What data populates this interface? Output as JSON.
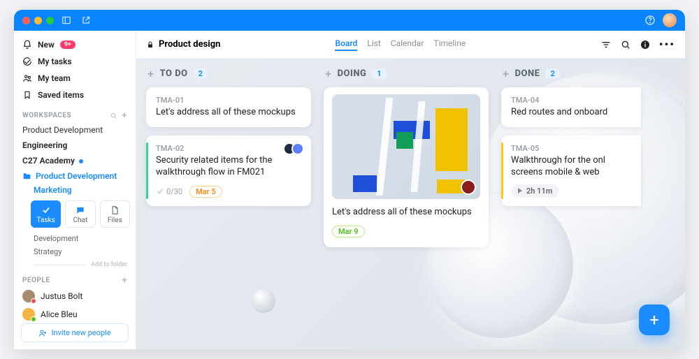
{
  "titlebar": {},
  "sidebar": {
    "new_label": "New",
    "new_count": "9+",
    "my_tasks": "My tasks",
    "my_team": "My team",
    "saved": "Saved items",
    "workspaces_title": "WORKSPACES",
    "workspaces": [
      "Product Development",
      "Engineering",
      "C27 Academy"
    ],
    "folder": "Product Development",
    "subfolder": "Marketing",
    "tabs": {
      "tasks": "Tasks",
      "chat": "Chat",
      "files": "Files"
    },
    "sub1": "Development",
    "sub2": "Strategy",
    "add_folder": "Add to folder",
    "people_title": "PEOPLE",
    "people": [
      {
        "name": "Justus Bolt",
        "color": "#a68b6d",
        "status": "#ff4d4f"
      },
      {
        "name": "Alice Bleu",
        "color": "#f5b342",
        "status": "#52c41a"
      }
    ],
    "invite": "Invite new people"
  },
  "header": {
    "title": "Product design",
    "views": [
      "Board",
      "List",
      "Calendar",
      "Timeline"
    ]
  },
  "columns": [
    {
      "title": "TO DO",
      "count": "2",
      "cards": [
        {
          "id": "TMA-01",
          "title": "Let's address all of these mockups"
        },
        {
          "id": "TMA-02",
          "title": "Security related items for the walkthrough flow in FM021",
          "stripe": "#34d399",
          "progress": "0/30",
          "date": "Mar 5",
          "assignees": [
            "#1f2a44",
            "#5b7fff"
          ]
        }
      ]
    },
    {
      "title": "DOING",
      "count": "1",
      "cards": [
        {
          "image": true,
          "title": "Let's address all of these mockups",
          "date": "Mar 9",
          "date_color": "green",
          "assignee_one": "#8b1d1d"
        }
      ]
    },
    {
      "title": "DONE",
      "count": "2",
      "cards": [
        {
          "id": "TMA-04",
          "title": "Red routes and onboard",
          "cut": true
        },
        {
          "id": "TMA-05",
          "title": "Walkthrough for the onl screens mobile & web",
          "stripe": "#facc15",
          "timer": "2h 11m",
          "cut": true
        }
      ]
    }
  ]
}
